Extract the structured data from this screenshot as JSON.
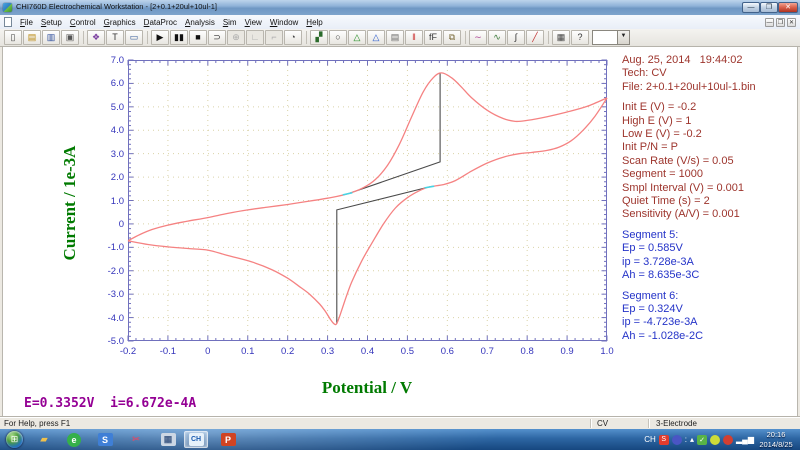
{
  "window": {
    "title": "CHI760D Electrochemical Workstation - [2+0.1+20ul+10ul-1]",
    "controls": {
      "minimize": "—",
      "maximize": "❐",
      "close": "✕"
    }
  },
  "menu": {
    "items": [
      "File",
      "Setup",
      "Control",
      "Graphics",
      "DataProc",
      "Analysis",
      "Sim",
      "View",
      "Window",
      "Help"
    ],
    "mdi_controls": [
      "—",
      "❐",
      "✕"
    ]
  },
  "toolbar": {
    "buttons": [
      {
        "name": "new-file-icon",
        "glyph": "▯",
        "color": "#444"
      },
      {
        "name": "open-file-icon",
        "glyph": "▤",
        "color": "#b8860b"
      },
      {
        "name": "save-icon",
        "glyph": "▥",
        "color": "#2b4b9b"
      },
      {
        "name": "print-icon",
        "glyph": "▣",
        "color": "#555"
      },
      {
        "sep": true
      },
      {
        "name": "technique-icon",
        "glyph": "❖",
        "color": "#7a3fa0"
      },
      {
        "name": "text-annotation-icon",
        "glyph": "T",
        "color": "#333"
      },
      {
        "name": "parameters-icon",
        "glyph": "▭",
        "color": "#335a9b"
      },
      {
        "sep": true
      },
      {
        "name": "run-experiment-icon",
        "glyph": "▶",
        "color": "#111"
      },
      {
        "name": "pause-icon",
        "glyph": "▮▮",
        "color": "#111"
      },
      {
        "name": "stop-icon",
        "glyph": "■",
        "color": "#111"
      },
      {
        "name": "reverse-scan-icon",
        "glyph": "⊃",
        "color": "#333"
      },
      {
        "name": "zero-current-icon",
        "glyph": "⊕",
        "color": "#aaa",
        "disabled": true
      },
      {
        "name": "it-curve-icon",
        "glyph": "∟",
        "color": "#aaa",
        "disabled": true
      },
      {
        "name": "cell-control-icon",
        "glyph": "⌐",
        "color": "#aaa",
        "disabled": true
      },
      {
        "name": "timer-icon",
        "glyph": "◔",
        "color": "#444"
      },
      {
        "sep": true
      },
      {
        "name": "present-data-icon",
        "glyph": "▞",
        "color": "#2b6b2b"
      },
      {
        "name": "zoom-icon",
        "glyph": "○",
        "color": "#333"
      },
      {
        "name": "peak-anodic-icon",
        "glyph": "△",
        "color": "#1a8a1a"
      },
      {
        "name": "peak-cathodic-icon",
        "glyph": "△",
        "color": "#2255cc"
      },
      {
        "name": "overlay-plots-icon",
        "glyph": "▤",
        "color": "#666"
      },
      {
        "name": "color-legend-icon",
        "glyph": "‖",
        "color": "#cc3333"
      },
      {
        "name": "font-icon",
        "glyph": "fF",
        "color": "#333"
      },
      {
        "name": "copy-graph-icon",
        "glyph": "⧉",
        "color": "#7a6a3a"
      },
      {
        "sep": true
      },
      {
        "name": "smoothing-icon",
        "glyph": "∼",
        "color": "#b04a9a"
      },
      {
        "name": "derivative-icon",
        "glyph": "∿",
        "color": "#3a7a3a"
      },
      {
        "name": "integration-icon",
        "glyph": "∫",
        "color": "#333"
      },
      {
        "name": "baseline-correction-icon",
        "glyph": "╱",
        "color": "#c03333"
      },
      {
        "sep": true
      },
      {
        "name": "data-grid-icon",
        "glyph": "▦",
        "color": "#444"
      },
      {
        "name": "context-help-icon",
        "glyph": "?",
        "color": "#333"
      }
    ],
    "combo": {
      "value": "",
      "arrow": "▼"
    }
  },
  "panel": {
    "header_lines": [
      "Aug. 25, 2014   19:44:02",
      "Tech: CV",
      "File: 2+0.1+20ul+10ul-1.bin"
    ],
    "params": [
      "Init E (V) = -0.2",
      "High E (V) = 1",
      "Low E (V) = -0.2",
      "Init P/N = P",
      "Scan Rate (V/s) = 0.05",
      "Segment = 1000",
      "Smpl Interval (V) = 0.001",
      "Quiet Time (s) = 2",
      "Sensitivity (A/V) = 0.001"
    ],
    "segments": [
      {
        "title": "Segment 5:",
        "lines": [
          "Ep = 0.585V",
          "ip = 3.728e-3A",
          "Ah = 8.635e-3C"
        ]
      },
      {
        "title": "Segment 6:",
        "lines": [
          "Ep = 0.324V",
          "ip = -4.723e-3A",
          "Ah = -1.028e-2C"
        ]
      }
    ]
  },
  "overlay": {
    "readout": "E=0.3352V  i=6.672e-4A"
  },
  "statusbar": {
    "help": "For Help, press F1",
    "tech": "CV",
    "electrode": "3-Electrode"
  },
  "taskbar": {
    "apps": [
      {
        "name": "taskbar-explorer-icon",
        "glyph": "▰",
        "fg": "#f0c14b",
        "bg": "none"
      },
      {
        "name": "taskbar-browser-icon",
        "glyph": "e",
        "fg": "#fff",
        "bg": "#35b04a",
        "shape": "circle"
      },
      {
        "name": "taskbar-sogou-icon",
        "glyph": "S",
        "fg": "#fff",
        "bg": "#3f7fd6"
      },
      {
        "name": "taskbar-screenshot-icon",
        "glyph": "✂",
        "fg": "#d05070",
        "bg": "none"
      },
      {
        "name": "taskbar-calculator-icon",
        "glyph": "▦",
        "fg": "#46618a",
        "bg": "#ccd7e4"
      },
      {
        "name": "taskbar-chi-app-icon",
        "glyph": "CH",
        "fg": "#1a5bb0",
        "bg": "#e6f1fa",
        "active": true
      },
      {
        "name": "taskbar-powerpoint-icon",
        "glyph": "P",
        "fg": "#fff",
        "bg": "#d04423"
      }
    ],
    "tray": [
      {
        "name": "tray-language-indicator",
        "text": "CH"
      },
      {
        "name": "tray-sogou-icon",
        "glyph": "S",
        "bg": "#e23c2e"
      },
      {
        "name": "tray-app-blue-icon",
        "glyph": "",
        "bg": "#4a55c4",
        "shape": "circle"
      },
      {
        "name": "tray-dots-icon",
        "text": ":"
      },
      {
        "name": "tray-hidden-icons-arrow",
        "text": "▴"
      },
      {
        "name": "tray-shield-icon",
        "glyph": "✓",
        "bg": "#58b347"
      },
      {
        "name": "tray-360-icon",
        "glyph": "",
        "bg": "#cddc39",
        "shape": "circle"
      },
      {
        "name": "tray-red-app-icon",
        "glyph": "",
        "bg": "#d23f31",
        "shape": "circle"
      },
      {
        "name": "tray-network-icon",
        "text": "▂▄▆"
      }
    ],
    "clock_time": "20:16",
    "clock_date": "2014/8/25"
  },
  "chart_data": {
    "type": "line",
    "xlabel": "Potential / V",
    "ylabel": "Current / 1e-3A",
    "xlim": [
      -0.2,
      1.0
    ],
    "ylim": [
      -5.0,
      7.0
    ],
    "x_minor_step": 0.02,
    "y_minor_step": 0.2,
    "grid": "dotted",
    "grid_color": "#d9d2a6",
    "frame_color": "#7070bd",
    "curve_color": "#f58282",
    "baseline_color": "#4a4a4a",
    "marker_color": "#45d5e5",
    "xticks": [
      {
        "v": -0.2,
        "label": "-0.2"
      },
      {
        "v": -0.1,
        "label": "-0.1"
      },
      {
        "v": 0,
        "label": "0"
      },
      {
        "v": 0.1,
        "label": "0.1"
      },
      {
        "v": 0.2,
        "label": "0.2"
      },
      {
        "v": 0.3,
        "label": "0.3"
      },
      {
        "v": 0.4,
        "label": "0.4"
      },
      {
        "v": 0.5,
        "label": "0.5"
      },
      {
        "v": 0.6,
        "label": "0.6"
      },
      {
        "v": 0.7,
        "label": "0.7"
      },
      {
        "v": 0.8,
        "label": "0.8"
      },
      {
        "v": 0.9,
        "label": "0.9"
      },
      {
        "v": 1.0,
        "label": "1.0"
      }
    ],
    "yticks": [
      {
        "v": 7,
        "label": "7.0"
      },
      {
        "v": 6,
        "label": "6.0"
      },
      {
        "v": 5,
        "label": "5.0"
      },
      {
        "v": 4,
        "label": "4.0"
      },
      {
        "v": 3,
        "label": "3.0"
      },
      {
        "v": 2,
        "label": "2.0"
      },
      {
        "v": 1,
        "label": "1.0"
      },
      {
        "v": 0,
        "label": "0"
      },
      {
        "v": -1,
        "label": "-1.0"
      },
      {
        "v": -2,
        "label": "-2.0"
      },
      {
        "v": -3,
        "label": "-3.0"
      },
      {
        "v": -4,
        "label": "-4.0"
      },
      {
        "v": -5,
        "label": "-5.0"
      }
    ],
    "series": [
      {
        "name": "forward-anodic-scan",
        "points": [
          [
            -0.2,
            -0.72
          ],
          [
            -0.17,
            -0.45
          ],
          [
            -0.14,
            -0.24
          ],
          [
            -0.1,
            -0.05
          ],
          [
            -0.05,
            0.12
          ],
          [
            0,
            0.27
          ],
          [
            0.05,
            0.45
          ],
          [
            0.1,
            0.6
          ],
          [
            0.15,
            0.72
          ],
          [
            0.2,
            0.83
          ],
          [
            0.25,
            0.96
          ],
          [
            0.3,
            1.1
          ],
          [
            0.35,
            1.28
          ],
          [
            0.39,
            1.55
          ],
          [
            0.42,
            1.9
          ],
          [
            0.45,
            2.5
          ],
          [
            0.48,
            3.4
          ],
          [
            0.51,
            4.55
          ],
          [
            0.54,
            5.65
          ],
          [
            0.565,
            6.25
          ],
          [
            0.585,
            6.45
          ],
          [
            0.61,
            6.25
          ],
          [
            0.635,
            5.85
          ],
          [
            0.66,
            5.4
          ],
          [
            0.7,
            4.85
          ],
          [
            0.74,
            4.5
          ],
          [
            0.77,
            4.38
          ],
          [
            0.8,
            4.42
          ],
          [
            0.85,
            4.58
          ],
          [
            0.9,
            4.78
          ],
          [
            0.95,
            5.02
          ],
          [
            1,
            5.38
          ]
        ]
      },
      {
        "name": "reverse-cathodic-scan",
        "points": [
          [
            1,
            5.38
          ],
          [
            0.97,
            4.6
          ],
          [
            0.94,
            4.0
          ],
          [
            0.91,
            3.55
          ],
          [
            0.88,
            3.28
          ],
          [
            0.85,
            3.14
          ],
          [
            0.81,
            3.05
          ],
          [
            0.78,
            3.0
          ],
          [
            0.74,
            2.85
          ],
          [
            0.7,
            2.6
          ],
          [
            0.66,
            2.25
          ],
          [
            0.62,
            1.85
          ],
          [
            0.59,
            1.68
          ],
          [
            0.555,
            1.58
          ],
          [
            0.53,
            1.42
          ],
          [
            0.5,
            1.12
          ],
          [
            0.47,
            0.68
          ],
          [
            0.44,
            0.0
          ],
          [
            0.41,
            -0.85
          ],
          [
            0.385,
            -1.6
          ],
          [
            0.36,
            -2.5
          ],
          [
            0.345,
            -3.2
          ],
          [
            0.332,
            -3.85
          ],
          [
            0.323,
            -4.25
          ],
          [
            0.317,
            -4.28
          ],
          [
            0.308,
            -4.1
          ],
          [
            0.295,
            -3.75
          ],
          [
            0.28,
            -3.42
          ],
          [
            0.255,
            -3.0
          ],
          [
            0.23,
            -2.68
          ],
          [
            0.2,
            -2.32
          ],
          [
            0.16,
            -1.95
          ],
          [
            0.11,
            -1.62
          ],
          [
            0.05,
            -1.35
          ],
          [
            0,
            -1.12
          ],
          [
            -0.05,
            -1.05
          ],
          [
            -0.1,
            -0.98
          ],
          [
            -0.15,
            -0.88
          ],
          [
            -0.2,
            -0.72
          ]
        ]
      }
    ],
    "baselines": [
      {
        "name": "anodic-peak-baseline",
        "points": [
          [
            0.353,
            1.3
          ],
          [
            0.582,
            2.65
          ],
          [
            0.582,
            6.43
          ]
        ]
      },
      {
        "name": "cathodic-peak-baseline",
        "points": [
          [
            0.555,
            1.58
          ],
          [
            0.323,
            0.6
          ],
          [
            0.323,
            -4.26
          ]
        ]
      }
    ],
    "markers": [
      {
        "name": "baseline-anchor-1",
        "points": [
          [
            0.338,
            1.24
          ],
          [
            0.362,
            1.33
          ]
        ]
      },
      {
        "name": "baseline-anchor-2",
        "points": [
          [
            0.543,
            1.54
          ],
          [
            0.567,
            1.61
          ]
        ]
      }
    ],
    "annotations": {
      "anodic_peak": {
        "Ep": 0.585,
        "ip_mA": 3.728
      },
      "cathodic_peak": {
        "Ep": 0.324,
        "ip_mA": -4.723
      }
    }
  }
}
